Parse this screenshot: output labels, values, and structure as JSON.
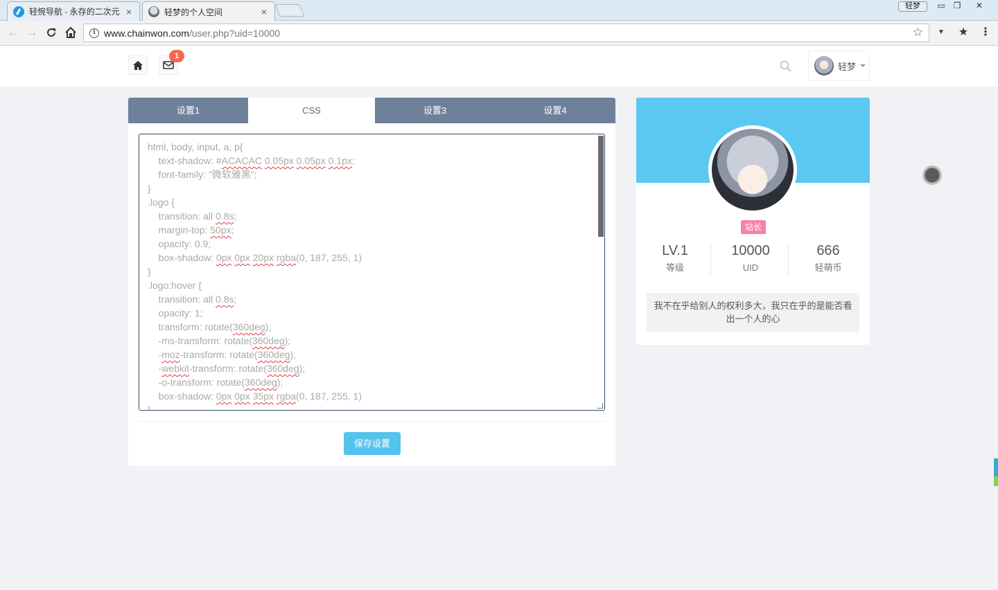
{
  "browser": {
    "tabs": [
      {
        "title": "轻惋导航 - 永存的二次元",
        "close": "×"
      },
      {
        "title": "轻梦的个人空间",
        "close": "×"
      }
    ],
    "profile_chip": "轻梦",
    "url_host": "www.chainwon.com",
    "url_path": "/user.php?uid=10000",
    "window_controls": [
      "▭",
      "❐",
      "✕"
    ]
  },
  "header": {
    "mail_badge": "1",
    "user_name": "轻梦"
  },
  "settings": {
    "tabs": [
      "设置1",
      "CSS",
      "设置3",
      "设置4"
    ],
    "active_tab": "CSS",
    "save_label": "保存设置"
  },
  "profile": {
    "role": "站长",
    "stats": [
      {
        "value": "LV.1",
        "label": "等级"
      },
      {
        "value": "10000",
        "label": "UID"
      },
      {
        "value": "666",
        "label": "轻萌币"
      }
    ],
    "bio": "我不在乎给别人的权利多大，我只在乎的是能否看出一个人的心"
  },
  "colors": {
    "tab_bar": "#6f809b",
    "banner": "#5bc8f2",
    "save_button": "#54c3ee",
    "role_badge": "#f583a8",
    "badge": "#f2694f"
  }
}
